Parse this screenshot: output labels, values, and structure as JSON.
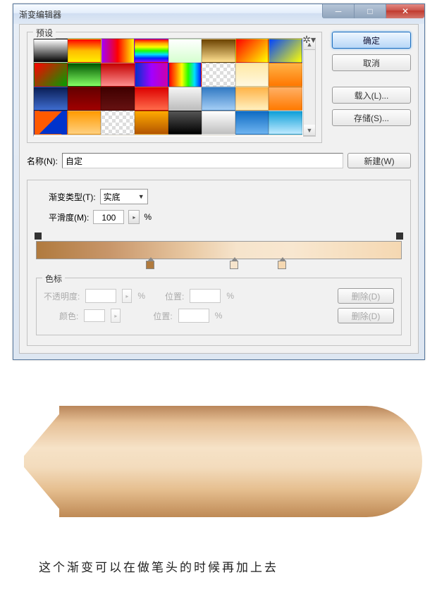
{
  "window": {
    "title": "渐变编辑器"
  },
  "presets": {
    "legend": "预设"
  },
  "buttons": {
    "ok": "确定",
    "cancel": "取消",
    "load": "载入(L)...",
    "save": "存储(S)...",
    "new": "新建(W)"
  },
  "name": {
    "label": "名称(N):",
    "value": "自定"
  },
  "gradient": {
    "type_label": "渐变类型(T):",
    "type_value": "实底",
    "smoothness_label": "平滑度(M):",
    "smoothness_value": "100",
    "percent": "%"
  },
  "stops": {
    "legend": "色标",
    "opacity_label": "不透明度:",
    "color_label": "颜色:",
    "location_label": "位置:",
    "delete_label": "删除(D)",
    "percent": "%"
  },
  "caption": "这个渐变可以在做笔头的时候再加上去",
  "chart_data": {
    "type": "gradient",
    "color_stops": [
      {
        "position": 30,
        "color": "#b07a3e"
      },
      {
        "position": 53,
        "color": "#f6e4cc"
      },
      {
        "position": 66,
        "color": "#f5d8b2"
      }
    ],
    "opacity_stops": [
      {
        "position": 0,
        "opacity": 100
      },
      {
        "position": 100,
        "opacity": 100
      }
    ]
  }
}
